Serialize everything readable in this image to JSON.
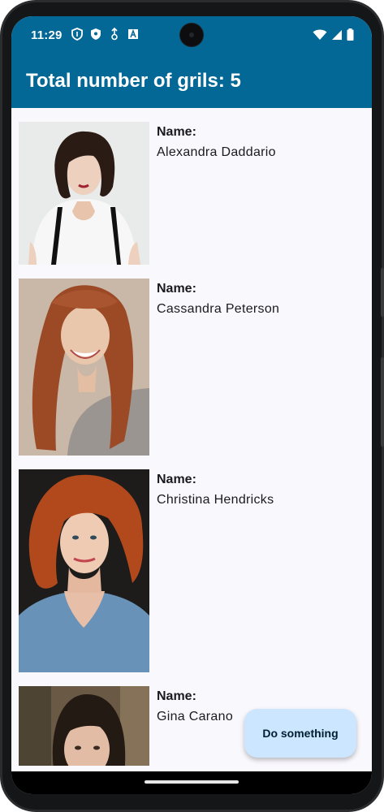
{
  "status_bar": {
    "time": "11:29",
    "left_icons": [
      "shield-outline-icon",
      "shield-filled-icon",
      "usb-debug-icon",
      "font-a-icon"
    ],
    "right_icons": [
      "wifi-icon",
      "signal-icon",
      "battery-icon"
    ]
  },
  "app_bar": {
    "title": "Total number of grils: 5"
  },
  "list": {
    "items": [
      {
        "label": "Name:",
        "name": "Alexandra Daddario",
        "photo": "portrait-photo"
      },
      {
        "label": "Name:",
        "name": "Cassandra Peterson",
        "photo": "portrait-photo"
      },
      {
        "label": "Name:",
        "name": "Christina Hendricks",
        "photo": "portrait-photo"
      },
      {
        "label": "Name:",
        "name": "Gina Carano",
        "photo": "portrait-photo"
      }
    ]
  },
  "fab": {
    "label": "Do something"
  },
  "colors": {
    "app_bar": "#046896",
    "background": "#f9f8fd",
    "fab": "#cce6ff"
  }
}
